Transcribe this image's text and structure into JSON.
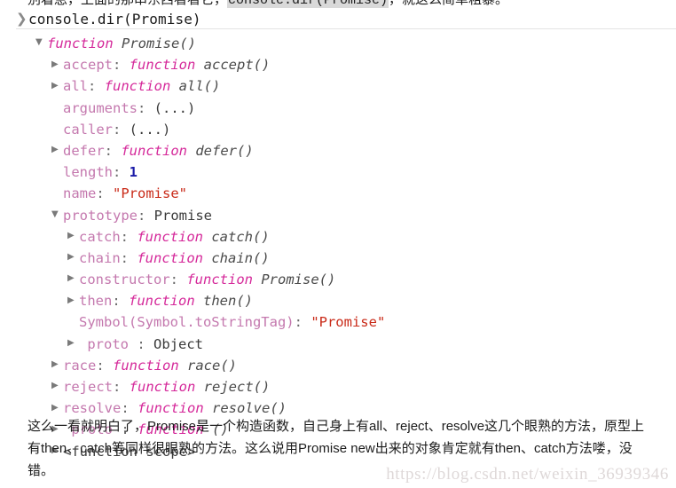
{
  "clipped_top": {
    "prefix": "别着急，上面的那串东西看看它，",
    "code": "console.dir(Promise)",
    "suffix": "，就这么简单粗暴。"
  },
  "console": {
    "prompt_icon": "chevron-right",
    "prompt_command": "console.dir(Promise)",
    "colors": {
      "property": "#c478ae",
      "keyword": "#d5299a",
      "string": "#c92a18",
      "number": "#1c1ca8",
      "function_name": "#4a4a4a",
      "triangle": "#7a7a7a"
    },
    "tree": [
      {
        "indent": 0,
        "toggle": "expanded",
        "kw": "function",
        "fname": "Promise()"
      },
      {
        "indent": 1,
        "toggle": "collapsed",
        "prop": "accept",
        "sep": ": ",
        "kw": "function",
        "fname": "accept()"
      },
      {
        "indent": 1,
        "toggle": "collapsed",
        "prop": "all",
        "sep": ": ",
        "kw": "function",
        "fname": "all()"
      },
      {
        "indent": 1,
        "toggle": "none",
        "prop": "arguments",
        "sep": ": ",
        "plain": "(...)"
      },
      {
        "indent": 1,
        "toggle": "none",
        "prop": "caller",
        "sep": ": ",
        "plain": "(...)"
      },
      {
        "indent": 1,
        "toggle": "collapsed",
        "prop": "defer",
        "sep": ": ",
        "kw": "function",
        "fname": "defer()"
      },
      {
        "indent": 1,
        "toggle": "none",
        "prop": "length",
        "sep": ": ",
        "num": "1"
      },
      {
        "indent": 1,
        "toggle": "none",
        "prop": "name",
        "sep": ": ",
        "str": "\"Promise\""
      },
      {
        "indent": 1,
        "toggle": "expanded",
        "prop": "prototype",
        "sep": ": ",
        "plain": "Promise"
      },
      {
        "indent": 2,
        "toggle": "collapsed",
        "prop": "catch",
        "sep": ": ",
        "kw": "function",
        "fname": "catch()"
      },
      {
        "indent": 2,
        "toggle": "collapsed",
        "prop": "chain",
        "sep": ": ",
        "kw": "function",
        "fname": "chain()"
      },
      {
        "indent": 2,
        "toggle": "collapsed",
        "prop": "constructor",
        "sep": ": ",
        "kw": "function",
        "fname": "Promise()"
      },
      {
        "indent": 2,
        "toggle": "collapsed",
        "prop": "then",
        "sep": ": ",
        "kw": "function",
        "fname": "then()"
      },
      {
        "indent": 2,
        "toggle": "none",
        "prop": "Symbol(Symbol.toStringTag)",
        "sep": ": ",
        "str": "\"Promise\""
      },
      {
        "indent": 2,
        "toggle": "collapsed",
        "prop": "  proto ",
        "sep": " : ",
        "plain": "Object"
      },
      {
        "indent": 1,
        "toggle": "collapsed",
        "prop": "race",
        "sep": ": ",
        "kw": "function",
        "fname": "race()"
      },
      {
        "indent": 1,
        "toggle": "collapsed",
        "prop": "reject",
        "sep": ": ",
        "kw": "function",
        "fname": "reject()"
      },
      {
        "indent": 1,
        "toggle": "collapsed",
        "prop": "resolve",
        "sep": ": ",
        "kw": "function",
        "fname": "resolve()"
      },
      {
        "indent": 1,
        "toggle": "collapsed",
        "prop": "  proto ",
        "sep": " : ",
        "kw": "function",
        "fname": "()"
      },
      {
        "indent": 1,
        "toggle": "collapsed",
        "scope": "<function scope>"
      }
    ]
  },
  "paragraph": {
    "text": "这么一看就明白了，Promise是一个构造函数，自己身上有all、reject、resolve这几个眼熟的方法，原型上有then、catch等同样很眼熟的方法。这么说用Promise new出来的对象肯定就有then、catch方法喽，没错。"
  },
  "watermark": {
    "text": "https://blog.csdn.net/weixin_36939346"
  }
}
